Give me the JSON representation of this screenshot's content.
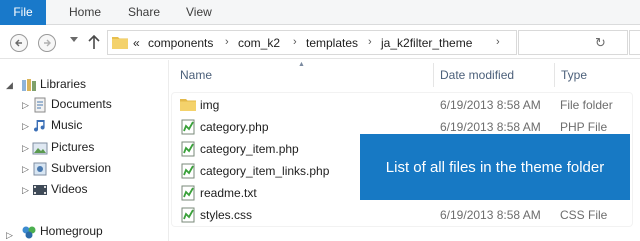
{
  "ribbon": {
    "tabs": [
      "File",
      "Home",
      "Share",
      "View"
    ]
  },
  "address": {
    "overflow": "«",
    "crumbs": [
      "components",
      "com_k2",
      "templates",
      "ja_k2filter_theme"
    ],
    "separator": "›",
    "refresh_glyph": "↻"
  },
  "nav_pane": {
    "items": [
      {
        "label": "Libraries",
        "icon": "libraries-icon"
      },
      {
        "label": "Documents",
        "icon": "documents-icon"
      },
      {
        "label": "Music",
        "icon": "music-icon"
      },
      {
        "label": "Pictures",
        "icon": "pictures-icon"
      },
      {
        "label": "Subversion",
        "icon": "subversion-icon"
      },
      {
        "label": "Videos",
        "icon": "videos-icon"
      },
      {
        "label": "Homegroup",
        "icon": "homegroup-icon"
      }
    ]
  },
  "columns": {
    "name": "Name",
    "date_modified": "Date modified",
    "type": "Type"
  },
  "files": [
    {
      "name": "img",
      "date": "6/19/2013 8:58 AM",
      "type": "File folder",
      "icon": "folder-icon"
    },
    {
      "name": "category.php",
      "date": "6/19/2013 8:58 AM",
      "type": "PHP File",
      "icon": "php-file-icon"
    },
    {
      "name": "category_item.php",
      "date": "",
      "type": "",
      "icon": "php-file-icon"
    },
    {
      "name": "category_item_links.php",
      "date": "",
      "type": "",
      "icon": "php-file-icon"
    },
    {
      "name": "readme.txt",
      "date": "",
      "type": "",
      "icon": "text-file-icon"
    },
    {
      "name": "styles.css",
      "date": "6/19/2013 8:58 AM",
      "type": "CSS File",
      "icon": "css-file-icon"
    }
  ],
  "callout": {
    "text": "List of all files in the theme folder"
  },
  "colors": {
    "accent": "#1979ca",
    "callout_bg": "#1779c4",
    "header_text": "#4c607a"
  }
}
